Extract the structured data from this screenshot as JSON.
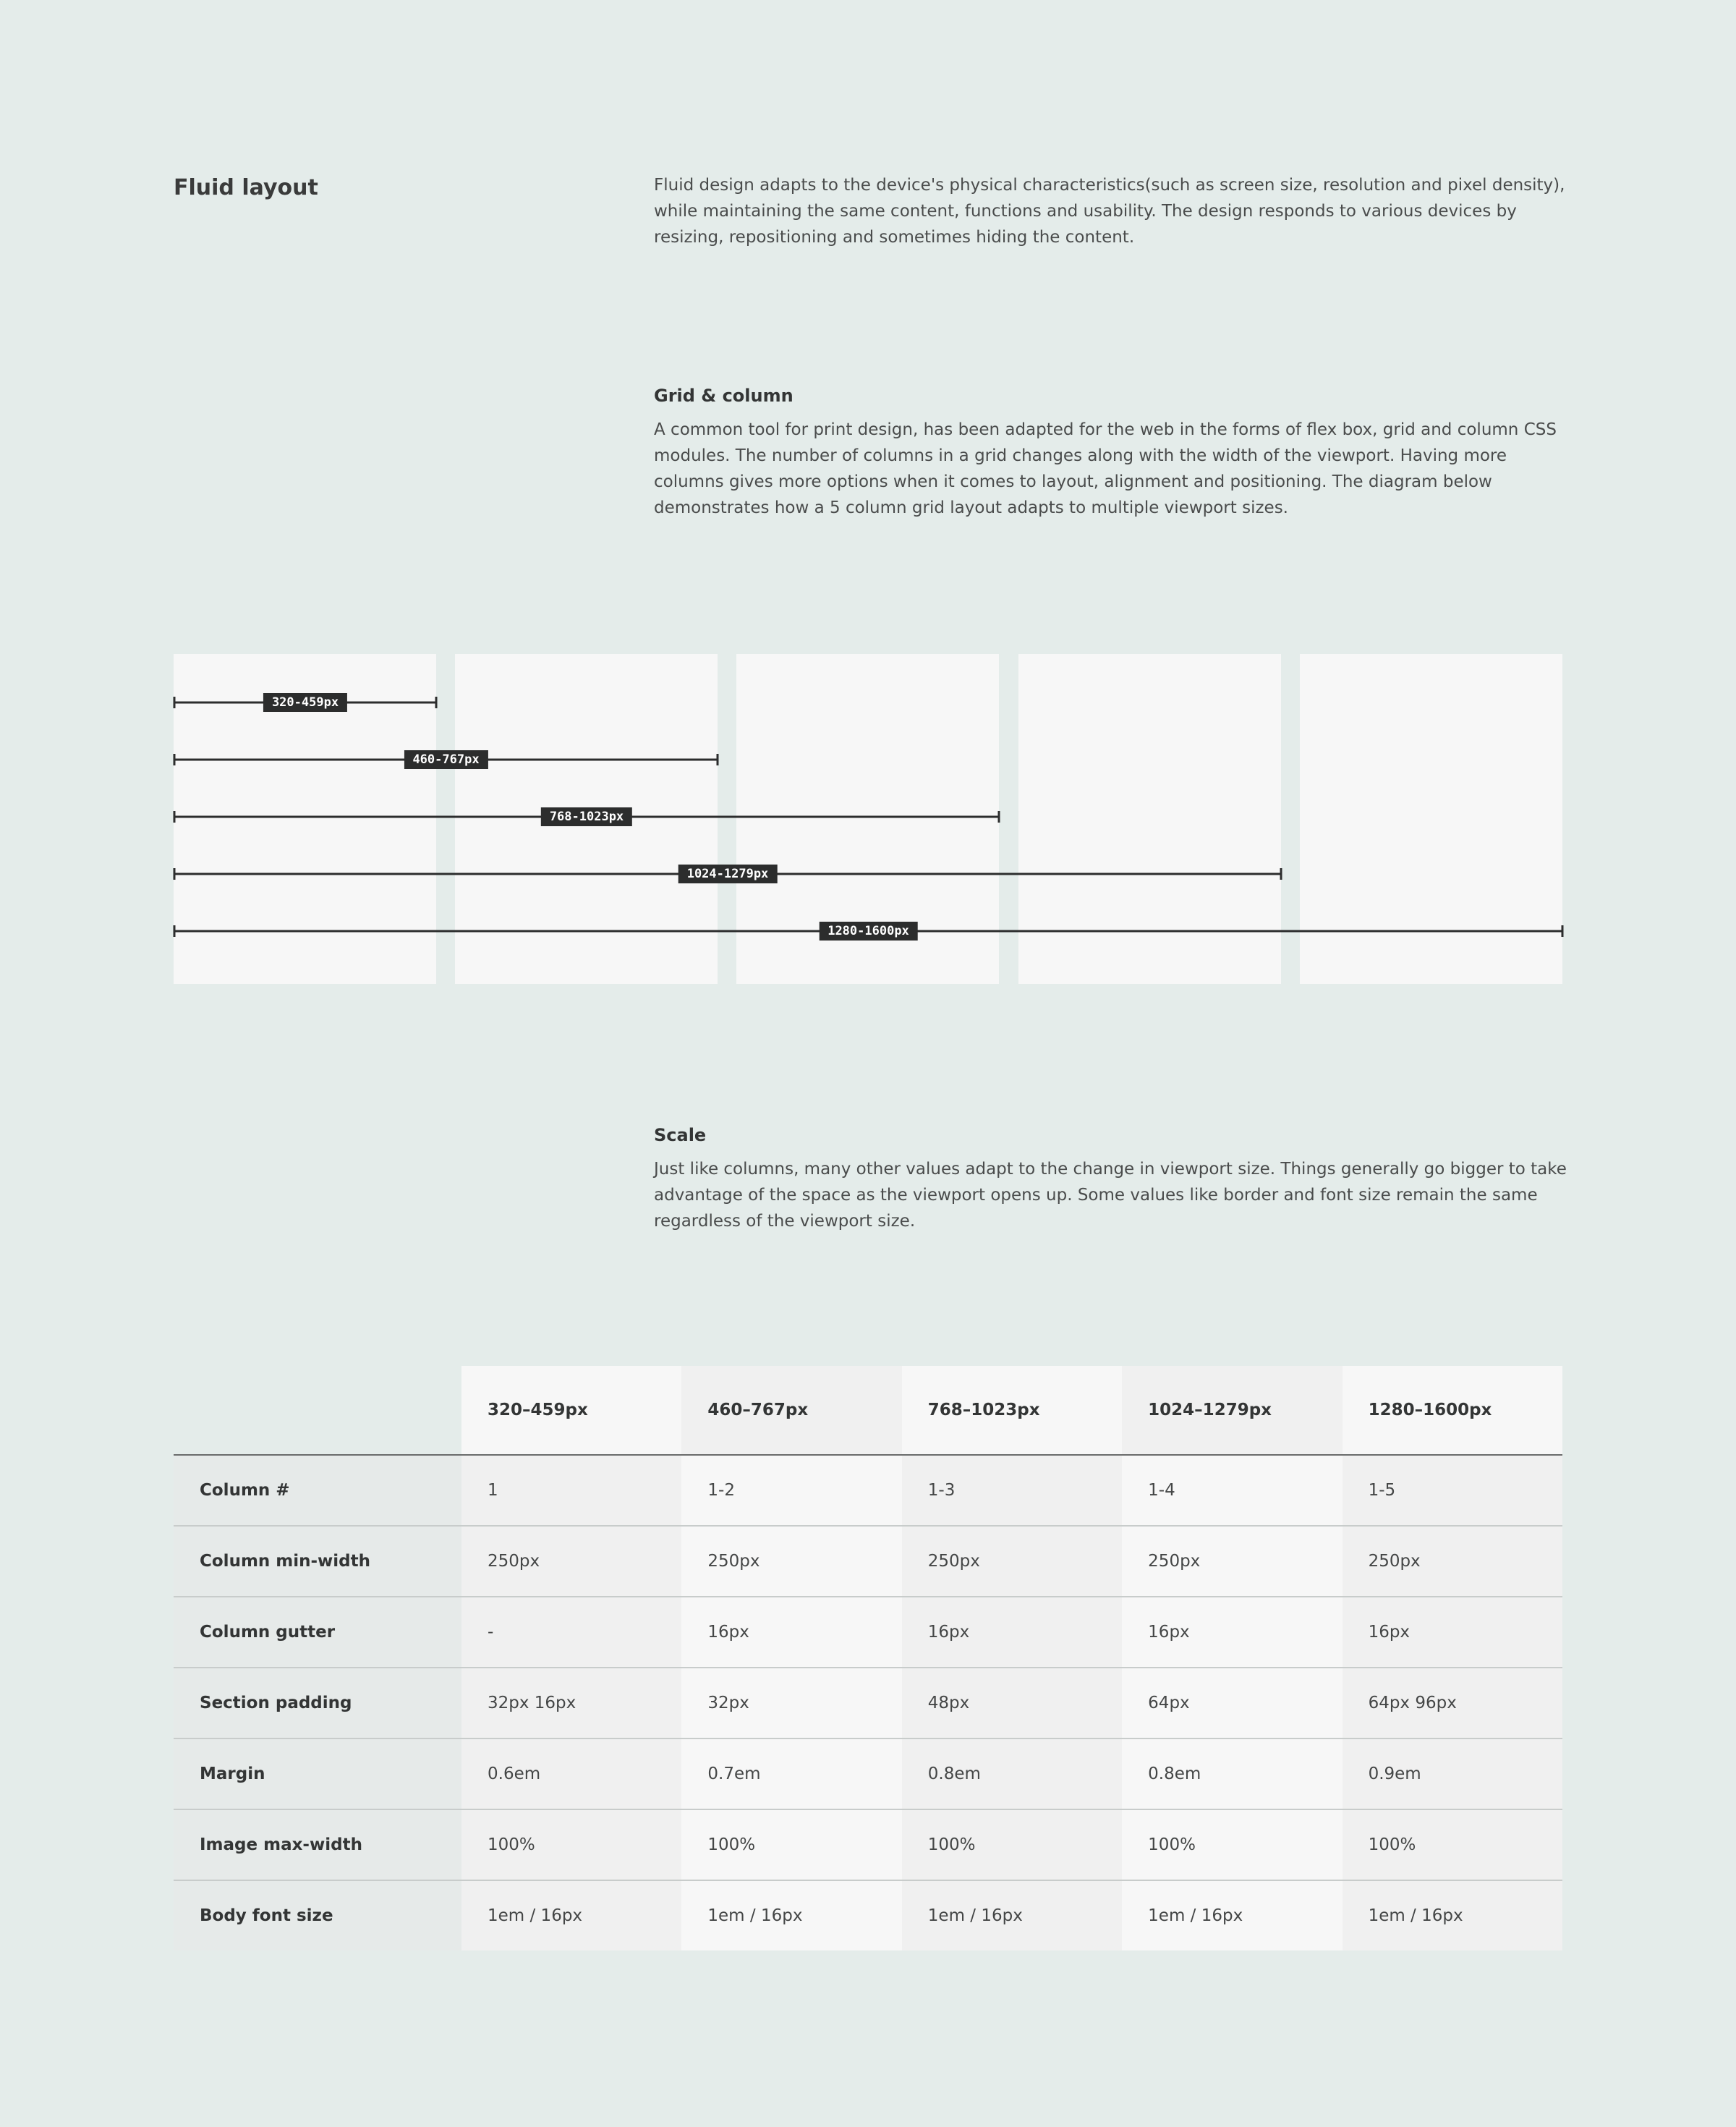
{
  "intro": {
    "title": "Fluid layout",
    "text": "Fluid design adapts to the device's physical characteristics(such as screen size, resolution and pixel density), while maintaining the same content, functions and usability. The design responds to various devices by resizing, repositioning and sometimes hiding the content."
  },
  "grid_section": {
    "heading": "Grid & column",
    "text": "A common tool for print design, has been adapted for the web in the forms of flex box, grid and column CSS modules. The number of columns in a grid changes along with the width of the viewport. Having more columns gives more options when it comes to layout, alignment and positioning. The diagram below demonstrates how a 5 column grid layout adapts to multiple viewport sizes."
  },
  "diagram": {
    "column_count": 5,
    "ranges": [
      {
        "label": "320-459px",
        "columns_spanned": 1
      },
      {
        "label": "460-767px",
        "columns_spanned": 2
      },
      {
        "label": "768-1023px",
        "columns_spanned": 3
      },
      {
        "label": "1024-1279px",
        "columns_spanned": 4
      },
      {
        "label": "1280-1600px",
        "columns_spanned": 5
      }
    ]
  },
  "scale_section": {
    "heading": "Scale",
    "text": "Just like columns, many other values adapt to the change in viewport size. Things generally go bigger to take advantage of the space as the viewport opens up. Some values like border and font size remain the same regardless of the viewport size."
  },
  "scale_table": {
    "headers": [
      "",
      "320–459px",
      "460–767px",
      "768–1023px",
      "1024–1279px",
      "1280–1600px"
    ],
    "rows": [
      [
        "Column #",
        "1",
        "1-2",
        "1-3",
        "1-4",
        "1-5"
      ],
      [
        "Column min-width",
        "250px",
        "250px",
        "250px",
        "250px",
        "250px"
      ],
      [
        "Column gutter",
        "-",
        "16px",
        "16px",
        "16px",
        "16px"
      ],
      [
        "Section padding",
        "32px 16px",
        "32px",
        "48px",
        "64px",
        "64px 96px"
      ],
      [
        "Margin",
        "0.6em",
        "0.7em",
        "0.8em",
        "0.8em",
        "0.9em"
      ],
      [
        "Image max-width",
        "100%",
        "100%",
        "100%",
        "100%",
        "100%"
      ],
      [
        "Body font size",
        "1em / 16px",
        "1em / 16px",
        "1em / 16px",
        "1em / 16px",
        "1em / 16px"
      ]
    ]
  },
  "colors": {
    "page_background": "#e4ecea",
    "column_fill": "#f7f7f7",
    "label_background": "#2c2d2d",
    "ruler_line": "#2c2d2d"
  }
}
